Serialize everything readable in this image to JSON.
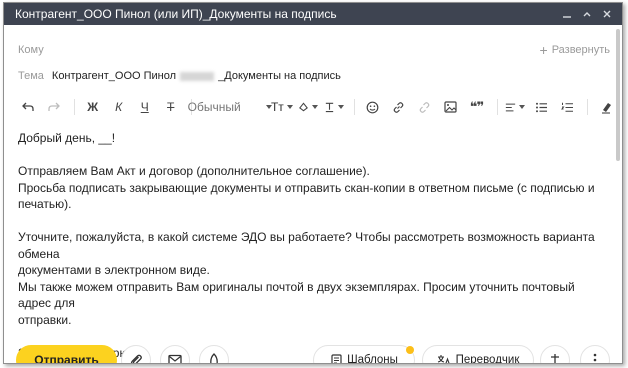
{
  "window": {
    "title": "Контрагент_ООО Пинол (или ИП)_Документы на подпись"
  },
  "to": {
    "label": "Кому",
    "expand_label": "Развернуть"
  },
  "subject": {
    "label": "Тема",
    "prefix": "Контрагент_ООО Пинол",
    "suffix": "_Документы на подпись"
  },
  "toolbar": {
    "bold": "Ж",
    "italic": "К",
    "underline": "Ч",
    "strike": "Т",
    "style_label": "Обычный",
    "font_size_label": "Тт",
    "quote": "❝❞"
  },
  "body": {
    "greeting": "Добрый день, __!",
    "p1_line1": "Отправляем Вам Акт и договор (дополнительное соглашение).",
    "p1_line2": "Просьба подписать закрывающие документы и отправить скан-копии в ответном письме (с подписью и",
    "p1_line3": "печатью).",
    "p2_line1": "Уточните, пожалуйста, в какой системе ЭДО вы работаете? Чтобы рассмотреть возможность варианта обмена",
    "p2_line2": "документами в электронном виде.",
    "p2_line3": "Мы также можем отправить Вам оригиналы почтой в двух экземплярах. Просим уточнить почтовый адрес для",
    "p2_line4": "отправки.",
    "closing": "Заранее благодарю!"
  },
  "footer": {
    "send_label": "Отправить",
    "templates_label": "Шаблоны",
    "translator_label": "Переводчик"
  },
  "colors": {
    "titlebar": "#3e4451",
    "accent": "#fcd21f",
    "notification_dot": "#fcbf19"
  }
}
